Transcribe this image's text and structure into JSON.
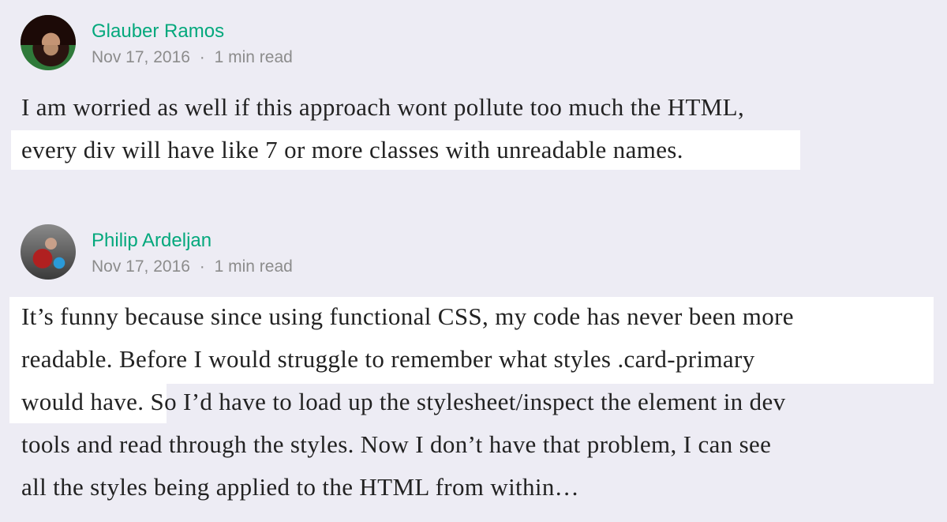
{
  "responses": [
    {
      "author": "Glauber Ramos",
      "date": "Nov 17, 2016",
      "separator": "·",
      "read_time": "1 min read",
      "lines": [
        "I am worried as well if this approach wont pollute too much the HTML,",
        "every div will have like 7 or more classes with unreadable names."
      ]
    },
    {
      "author": "Philip Ardeljan",
      "date": "Nov 17, 2016",
      "separator": "·",
      "read_time": "1 min read",
      "lines": [
        "It’s funny because since using functional CSS, my code has never been more",
        "readable. Before I would struggle to remember what styles .card-primary",
        "would have.",
        " So I’d have to load up the stylesheet/inspect the element in dev",
        "tools and read through the styles. Now I don’t have that problem, I can see",
        "all the styles being applied to the HTML from within…"
      ]
    }
  ],
  "colors": {
    "accent": "#03a87c",
    "background": "#edecf4",
    "highlight": "#ffffff"
  }
}
